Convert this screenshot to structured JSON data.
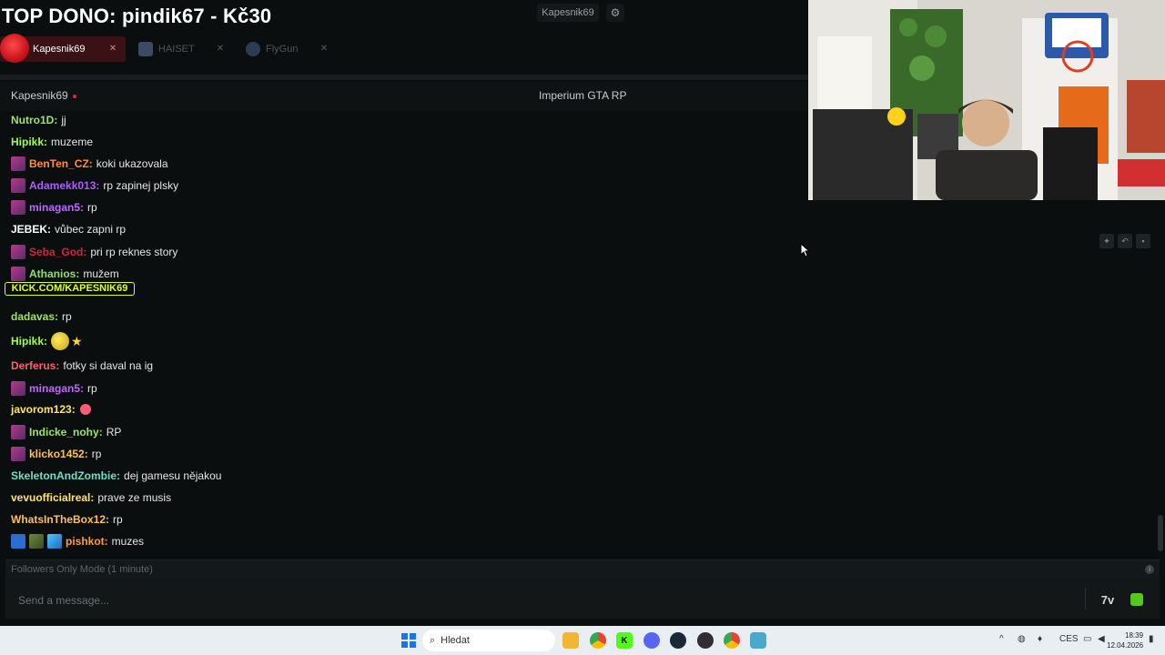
{
  "top_dono": "TOP DONO: pindik67 - Kč30",
  "top_bar": {
    "channel_button": "Kapesnik69",
    "settings_icon": "gear-icon"
  },
  "tabs": [
    {
      "label": "Kapesnik69",
      "active": true,
      "icon": "avatar-icon"
    },
    {
      "label": "HAISET",
      "active": false,
      "icon": "avatar-icon"
    },
    {
      "label": "FlyGun",
      "active": false,
      "icon": "avatar-icon"
    }
  ],
  "chat_header": {
    "channel": "Kapesnik69",
    "title": "Imperium GTA RP",
    "live_color": "#e0263b"
  },
  "overlay_text": "KICK.COM/KAPESNIK69",
  "messages": [
    {
      "user": "Nutro1D:",
      "text": "jj",
      "color": "#9ee26a",
      "badges": []
    },
    {
      "user": "Hipikk:",
      "text": "muzeme",
      "color": "#9cff4a",
      "badges": []
    },
    {
      "user": "BenTen_CZ:",
      "text": "koki ukazovala",
      "color": "#ff8c3a",
      "badges": [
        "sub"
      ]
    },
    {
      "user": "Adamekk013:",
      "text": "rp zapinej plsky",
      "color": "#b25cff",
      "badges": [
        "sub"
      ]
    },
    {
      "user": "minagan5:",
      "text": "rp",
      "color": "#c065ff",
      "badges": [
        "sub"
      ]
    },
    {
      "user": "JEBEK:",
      "text": "vůbec zapni rp",
      "color": "#ffffff",
      "badges": []
    },
    {
      "user": "Seba_God:",
      "text": "pri rp reknes story",
      "color": "#d3223b",
      "badges": [
        "sub"
      ]
    },
    {
      "user": "Athanios:",
      "text": "mužem",
      "color": "#8fe06a",
      "badges": [
        "sub"
      ]
    },
    {
      "user": "dadavas:",
      "text": "rp",
      "color": "#9ee26a",
      "badges": []
    },
    {
      "user": "Hipikk:",
      "text": "",
      "color": "#9cff4a",
      "badges": []
    },
    {
      "user": "Derferus:",
      "text": "fotky si daval na ig",
      "color": "#ff5f6d",
      "badges": []
    },
    {
      "user": "minagan5:",
      "text": "rp",
      "color": "#c065ff",
      "badges": [
        "sub"
      ]
    },
    {
      "user": "javorom123:",
      "text": "",
      "color": "#ffe46b",
      "badges": []
    },
    {
      "user": "Indicke_nohy:",
      "text": "RP",
      "color": "#9ee26a",
      "badges": [
        "sub"
      ]
    },
    {
      "user": "klicko1452:",
      "text": "rp",
      "color": "#ffbf5a",
      "badges": [
        "sub"
      ]
    },
    {
      "user": "SkeletonAndZombie:",
      "text": "dej gamesu nějakou",
      "color": "#6fe0c4",
      "badges": []
    },
    {
      "user": "vevuofficialreal:",
      "text": "prave ze musis",
      "color": "#ffe46b",
      "badges": []
    },
    {
      "user": "WhatsInTheBox12:",
      "text": "rp",
      "color": "#ffbf5a",
      "badges": []
    },
    {
      "user": "pishkot:",
      "text": "muzes",
      "color": "#ff9a3c",
      "badges": [
        "mod",
        "sub",
        "diamond"
      ]
    }
  ],
  "followers_mode": "Followers Only Mode (1 minute)",
  "input": {
    "placeholder": "Send a message..."
  },
  "taskbar": {
    "search_placeholder": "Hledat",
    "lang": "CES",
    "time": "18:39",
    "date": "12.04.2026"
  }
}
